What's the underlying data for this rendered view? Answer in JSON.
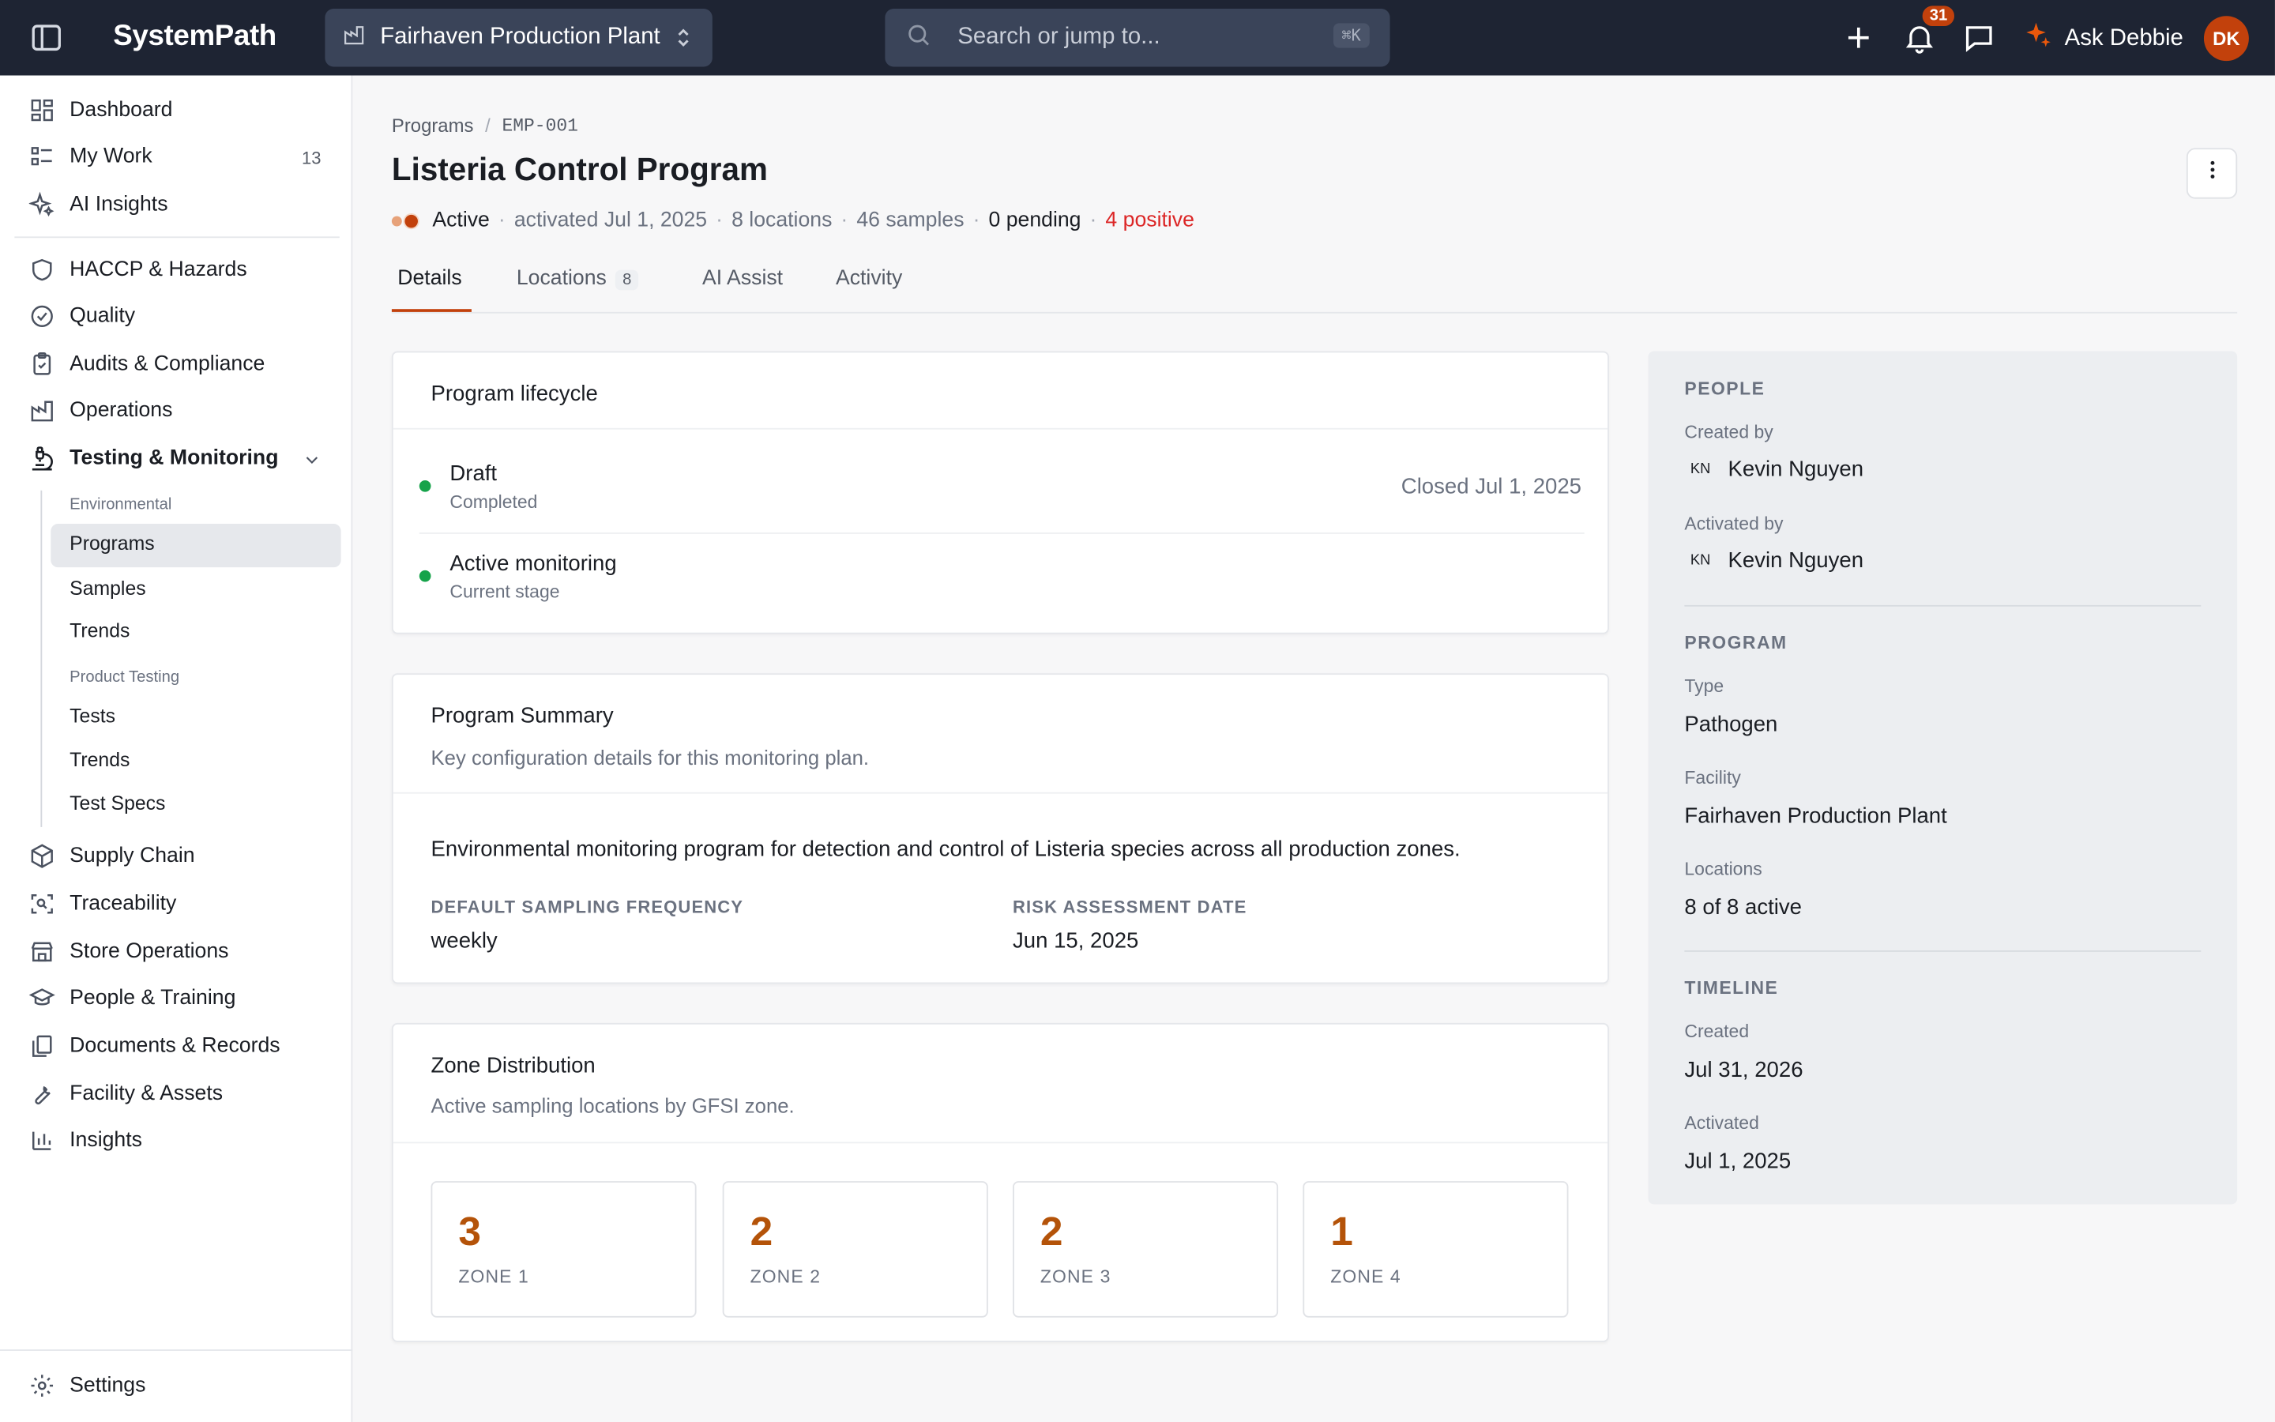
{
  "app": {
    "brand": "SystemPath",
    "plant": "Fairhaven Production Plant",
    "search_placeholder": "Search or jump to...",
    "search_shortcut": "⌘K",
    "notifications_count": "31",
    "ask_label": "Ask Debbie",
    "user_initials": "DK"
  },
  "sidebar": {
    "top": [
      {
        "label": "Dashboard",
        "icon": "grid-icon"
      },
      {
        "label": "My Work",
        "icon": "list-icon",
        "count": "13"
      },
      {
        "label": "AI Insights",
        "icon": "sparkle-icon"
      }
    ],
    "sections": [
      {
        "label": "HACCP & Hazards",
        "icon": "shield-icon"
      },
      {
        "label": "Quality",
        "icon": "check-circle-icon"
      },
      {
        "label": "Audits & Compliance",
        "icon": "clipboard-icon"
      },
      {
        "label": "Operations",
        "icon": "factory-icon"
      },
      {
        "label": "Testing & Monitoring",
        "icon": "microscope-icon"
      }
    ],
    "testing_sub": {
      "environmental_label": "Environmental",
      "environmental_items": [
        "Programs",
        "Samples",
        "Trends"
      ],
      "product_label": "Product Testing",
      "product_items": [
        "Tests",
        "Trends",
        "Test Specs"
      ]
    },
    "bottom": [
      {
        "label": "Supply Chain",
        "icon": "box-icon"
      },
      {
        "label": "Traceability",
        "icon": "scan-icon"
      },
      {
        "label": "Store Operations",
        "icon": "store-icon"
      },
      {
        "label": "People & Training",
        "icon": "graduation-cap-icon"
      },
      {
        "label": "Documents & Records",
        "icon": "documents-icon"
      },
      {
        "label": "Facility & Assets",
        "icon": "wrench-icon"
      },
      {
        "label": "Insights",
        "icon": "bar-chart-icon"
      }
    ],
    "settings_label": "Settings"
  },
  "page": {
    "breadcrumb_root": "Programs",
    "breadcrumb_code": "EMP-001",
    "title": "Listeria Control Program",
    "status": "Active",
    "activated": "activated Jul 1, 2025",
    "locations": "8 locations",
    "samples": "46 samples",
    "pending": "0 pending",
    "positive": "4 positive",
    "tabs": [
      {
        "label": "Details"
      },
      {
        "label": "Locations",
        "badge": "8"
      },
      {
        "label": "AI Assist"
      },
      {
        "label": "Activity"
      }
    ]
  },
  "lifecycle": {
    "title": "Program lifecycle",
    "stages": [
      {
        "name": "Draft",
        "sub": "Completed",
        "right": "Closed Jul 1, 2025"
      },
      {
        "name": "Active monitoring",
        "sub": "Current stage",
        "right": ""
      }
    ]
  },
  "summary": {
    "title": "Program Summary",
    "subtitle": "Key configuration details for this monitoring plan.",
    "description": "Environmental monitoring program for detection and control of Listeria species across all production zones.",
    "freq_label": "DEFAULT SAMPLING FREQUENCY",
    "freq_value": "weekly",
    "risk_label": "RISK ASSESSMENT DATE",
    "risk_value": "Jun 15, 2025"
  },
  "zones": {
    "title": "Zone Distribution",
    "subtitle": "Active sampling locations by GFSI zone.",
    "items": [
      {
        "count": "3",
        "label": "ZONE 1"
      },
      {
        "count": "2",
        "label": "ZONE 2"
      },
      {
        "count": "2",
        "label": "ZONE 3"
      },
      {
        "count": "1",
        "label": "ZONE 4"
      }
    ]
  },
  "aside": {
    "people_heading": "PEOPLE",
    "created_by_label": "Created by",
    "created_by_initials": "KN",
    "created_by_name": "Kevin Nguyen",
    "activated_by_label": "Activated by",
    "activated_by_initials": "KN",
    "activated_by_name": "Kevin Nguyen",
    "program_heading": "PROGRAM",
    "type_label": "Type",
    "type_value": "Pathogen",
    "facility_label": "Facility",
    "facility_value": "Fairhaven Production Plant",
    "locations_label": "Locations",
    "locations_value": "8 of 8 active",
    "timeline_heading": "TIMELINE",
    "created_label": "Created",
    "created_value": "Jul 31, 2026",
    "activated_label": "Activated",
    "activated_value": "Jul 1, 2025"
  },
  "colors": {
    "topbar": "#1e2433",
    "accent": "#c2410c",
    "zone_number": "#b45309",
    "positive": "#dc2626",
    "stage_dot": "#16a34a"
  }
}
